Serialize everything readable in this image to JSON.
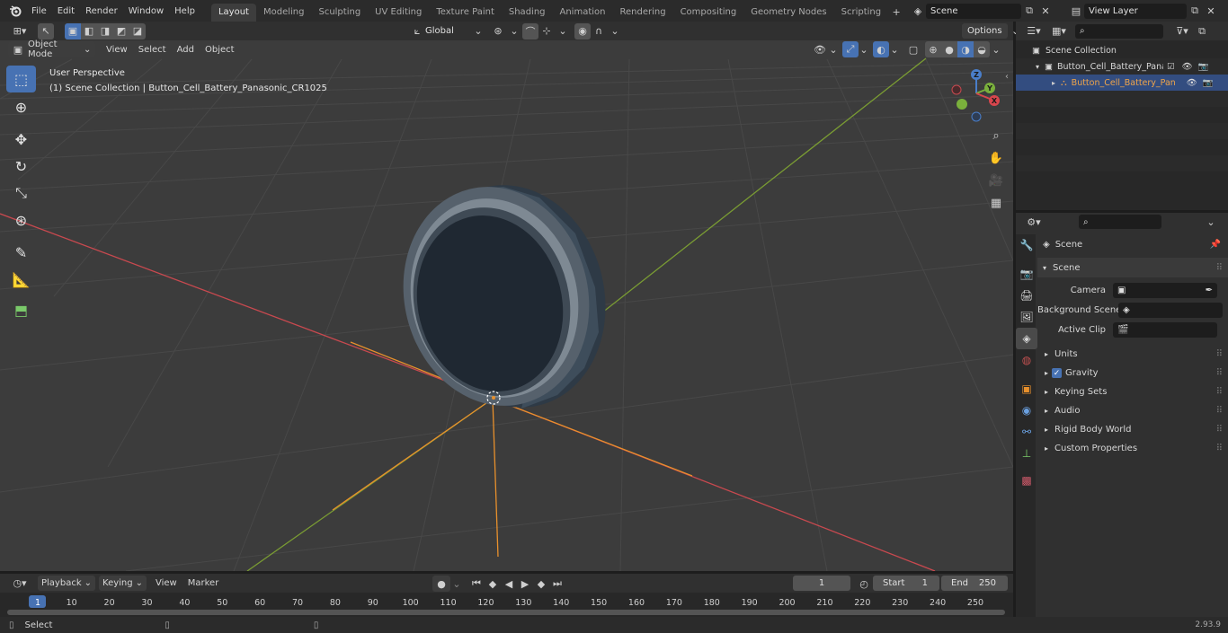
{
  "menu": {
    "file": "File",
    "edit": "Edit",
    "render": "Render",
    "window": "Window",
    "help": "Help"
  },
  "workspaces": [
    "Layout",
    "Modeling",
    "Sculpting",
    "UV Editing",
    "Texture Paint",
    "Shading",
    "Animation",
    "Rendering",
    "Compositing",
    "Geometry Nodes",
    "Scripting"
  ],
  "scene_name": "Scene",
  "view_layer": "View Layer",
  "viewport": {
    "mode": "Object Mode",
    "menus": {
      "view": "View",
      "select": "Select",
      "add": "Add",
      "object": "Object"
    },
    "orientation": "Global",
    "options": "Options",
    "overlay_title": "User Perspective",
    "overlay_sub": "(1) Scene Collection | Button_Cell_Battery_Panasonic_CR1025"
  },
  "gizmo": {
    "x": "X",
    "y": "Y",
    "z": "Z"
  },
  "outliner": {
    "root": "Scene Collection",
    "collection": "Button_Cell_Battery_Panasor",
    "object": "Button_Cell_Battery_Pan"
  },
  "properties": {
    "header": "Scene",
    "section": "Scene",
    "camera_label": "Camera",
    "bg_label": "Background Scene",
    "clip_label": "Active Clip",
    "panels": [
      "Units",
      "Gravity",
      "Keying Sets",
      "Audio",
      "Rigid Body World",
      "Custom Properties"
    ]
  },
  "timeline": {
    "playback": "Playback",
    "keying": "Keying",
    "view": "View",
    "marker": "Marker",
    "current": "1",
    "start_label": "Start",
    "start": "1",
    "end_label": "End",
    "end": "250",
    "ticks": [
      "1",
      "10",
      "20",
      "30",
      "40",
      "50",
      "60",
      "70",
      "80",
      "90",
      "100",
      "110",
      "120",
      "130",
      "140",
      "150",
      "160",
      "170",
      "180",
      "190",
      "200",
      "210",
      "220",
      "230",
      "240",
      "250"
    ]
  },
  "status": {
    "select": "Select",
    "version": "2.93.9"
  },
  "colors": {
    "accent": "#4772b3",
    "x_axis": "#c8494f",
    "y_axis": "#7a9c33",
    "orange": "#e8902c",
    "bg_viewport": "#3c3c3c"
  }
}
